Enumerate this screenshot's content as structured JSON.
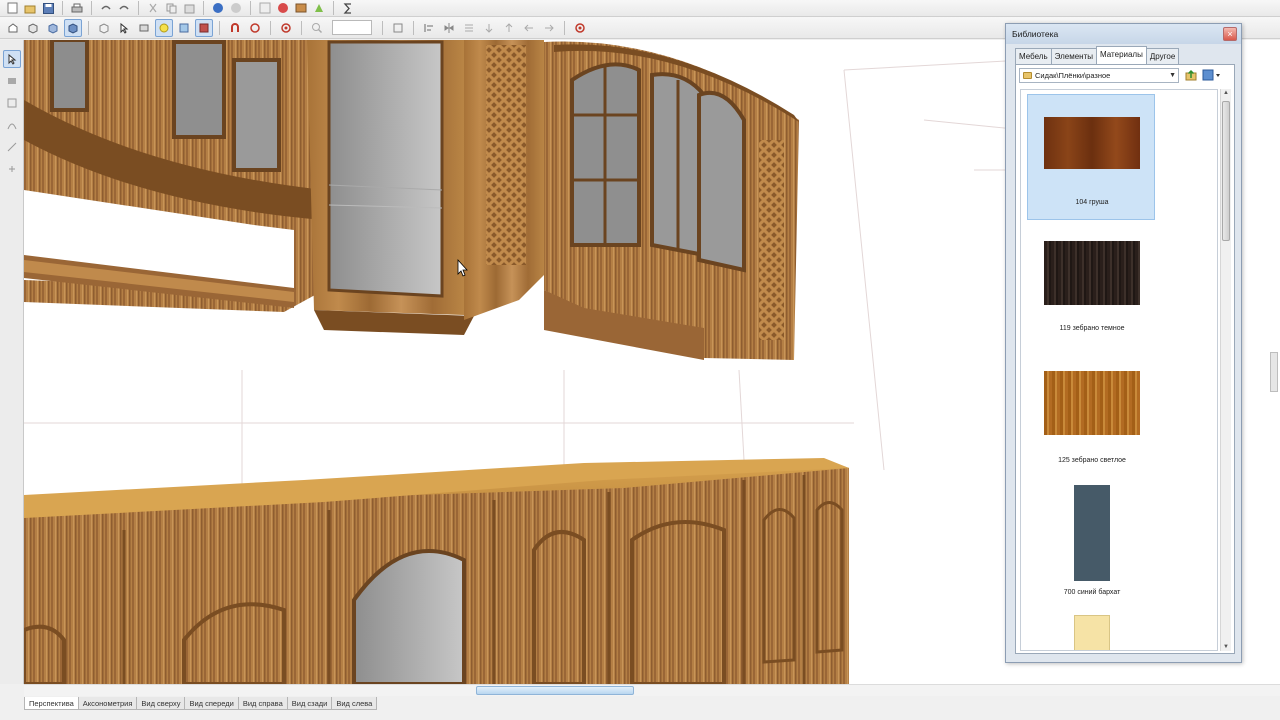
{
  "toolbar_row1": {
    "icons": [
      "new-icon",
      "open-icon",
      "save-icon",
      "print-icon",
      "undo-icon",
      "redo-icon",
      "cut-icon",
      "copy-icon",
      "paste-icon",
      "globe-icon",
      "sphere-icon",
      "texture-icon",
      "palette-icon",
      "shelf-icon",
      "render-icon",
      "sigma-icon"
    ]
  },
  "toolbar_row2": {
    "icons": [
      "rotate-icon",
      "cube-icon",
      "cube-front-icon",
      "cube-active-icon",
      "cube-side-icon",
      "select-icon",
      "move-icon",
      "light-icon",
      "box-icon",
      "grid-icon",
      "magnet-icon",
      "snap-icon",
      "center-icon",
      "zoom-icon",
      "zoom-value-icon",
      "edit-icon",
      "align-icon",
      "mirror-icon",
      "distribute-icon",
      "marker-icon"
    ]
  },
  "library": {
    "title": "Библиотека",
    "close": "×",
    "tabs": [
      "Мебель",
      "Элементы",
      "Материалы",
      "Другое"
    ],
    "active_tab": "Материалы",
    "path": "Сидак\\Плёнки\\разное",
    "items": [
      {
        "label": "104 груша",
        "color": "#7a3a14",
        "selected": true
      },
      {
        "label": "119 зебрано темное",
        "color": "#2e2420",
        "selected": false
      },
      {
        "label": "125 зебрано светлое",
        "color": "#b36b1e",
        "selected": false
      },
      {
        "label": "700 синий бархат",
        "color": "#465a68",
        "selected": false
      },
      {
        "label": "",
        "color": "#f6e3a6",
        "selected": false
      }
    ]
  },
  "view_tabs": [
    "Перспектива",
    "Аксонометрия",
    "Вид сверху",
    "Вид спереди",
    "Вид справа",
    "Вид сзади",
    "Вид слева"
  ],
  "active_view": "Перспектива",
  "colors": {
    "wood_light": "#b98545",
    "wood_dark": "#8a5a2b",
    "wood_top": "#d09a4e",
    "glass": "#9a9a9a",
    "selection": "#cde3f7"
  }
}
